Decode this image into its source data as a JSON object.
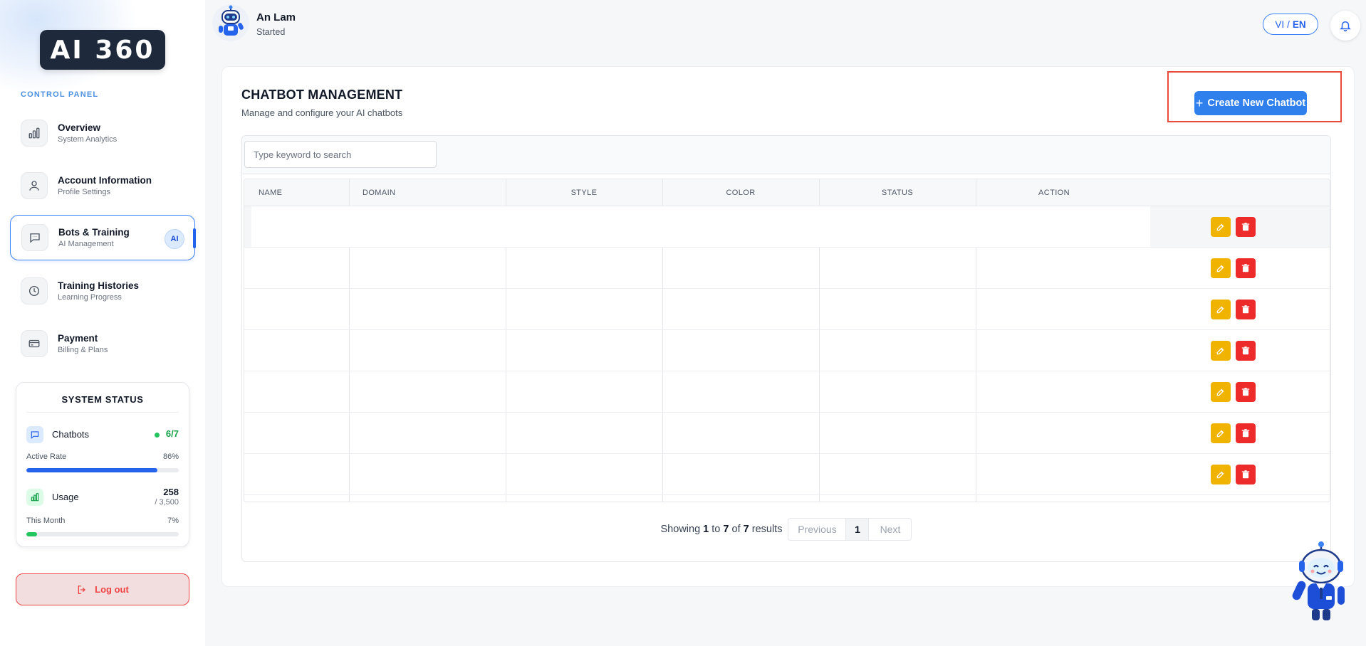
{
  "brand": {
    "logo_text": "AI 360"
  },
  "sidebar": {
    "section_label": "CONTROL PANEL",
    "items": [
      {
        "title": "Overview",
        "subtitle": "System Analytics",
        "icon": "bar-chart-icon"
      },
      {
        "title": "Account Information",
        "subtitle": "Profile Settings",
        "icon": "user-icon"
      },
      {
        "title": "Bots & Training",
        "subtitle": "AI Management",
        "icon": "chat-icon",
        "badge": "AI",
        "active": true
      },
      {
        "title": "Training Histories",
        "subtitle": "Learning Progress",
        "icon": "clock-icon"
      },
      {
        "title": "Payment",
        "subtitle": "Billing & Plans",
        "icon": "credit-card-icon"
      }
    ],
    "status": {
      "title": "SYSTEM STATUS",
      "chatbots": {
        "label": "Chatbots",
        "value": "6/7",
        "rate_label": "Active Rate",
        "rate_value": "86%",
        "rate_fraction": 0.86
      },
      "usage": {
        "label": "Usage",
        "value": "258",
        "limit": "/ 3,500",
        "month_label": "This Month",
        "month_value": "7%",
        "month_fraction": 0.07
      }
    },
    "logout_label": "Log out"
  },
  "header": {
    "user_name": "An Lam",
    "user_status": "Started",
    "lang_vi": "VI",
    "lang_sep": "/",
    "lang_en": "EN"
  },
  "main": {
    "title": "CHATBOT MANAGEMENT",
    "subtitle": "Manage and configure your AI chatbots",
    "create_button": "Create New Chatbot",
    "search_placeholder": "Type keyword to search",
    "columns": {
      "name": "NAME",
      "domain": "DOMAIN",
      "style": "STYLE",
      "color": "COLOR",
      "status": "STATUS",
      "action": "ACTION"
    },
    "row_count": 7,
    "pagination": {
      "showing_word": "Showing",
      "from": "1",
      "to_word": "to",
      "to": "7",
      "of_word": "of",
      "total": "7",
      "results_word": "results",
      "previous": "Previous",
      "page": "1",
      "next": "Next"
    }
  },
  "colors": {
    "accent": "#2f80ed",
    "edit": "#f0b400",
    "delete": "#ee2b2b",
    "success": "#22c55e",
    "logout": "#ef4444"
  }
}
